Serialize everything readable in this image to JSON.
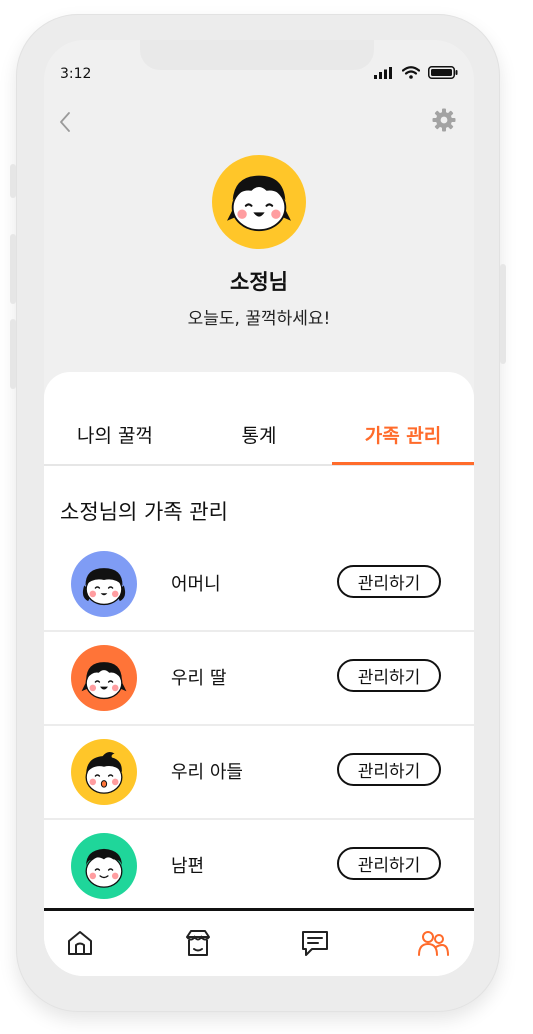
{
  "status_bar": {
    "time": "3:12"
  },
  "header": {
    "back_icon": "chevron-left-icon",
    "settings_icon": "gear-icon"
  },
  "profile": {
    "name": "소정님",
    "greeting": "오늘도, 꿀꺽하세요!",
    "avatar_color": "#ffc629"
  },
  "tabs": [
    {
      "label": "나의 꿀꺽",
      "active": false
    },
    {
      "label": "통계",
      "active": false
    },
    {
      "label": "가족 관리",
      "active": true
    }
  ],
  "accent_color": "#ff6b2b",
  "section_title": "소정님의 가족 관리",
  "family": [
    {
      "name": "어머니",
      "button": "관리하기",
      "avatar_color": "#7f9cf5"
    },
    {
      "name": "우리 딸",
      "button": "관리하기",
      "avatar_color": "#ff7438"
    },
    {
      "name": "우리 아들",
      "button": "관리하기",
      "avatar_color": "#ffc629"
    },
    {
      "name": "남편",
      "button": "관리하기",
      "avatar_color": "#1fd69a"
    }
  ],
  "bottom_nav": [
    {
      "icon": "home-icon",
      "active": false
    },
    {
      "icon": "shop-icon",
      "active": false
    },
    {
      "icon": "chat-icon",
      "active": false
    },
    {
      "icon": "family-icon",
      "active": true
    }
  ]
}
